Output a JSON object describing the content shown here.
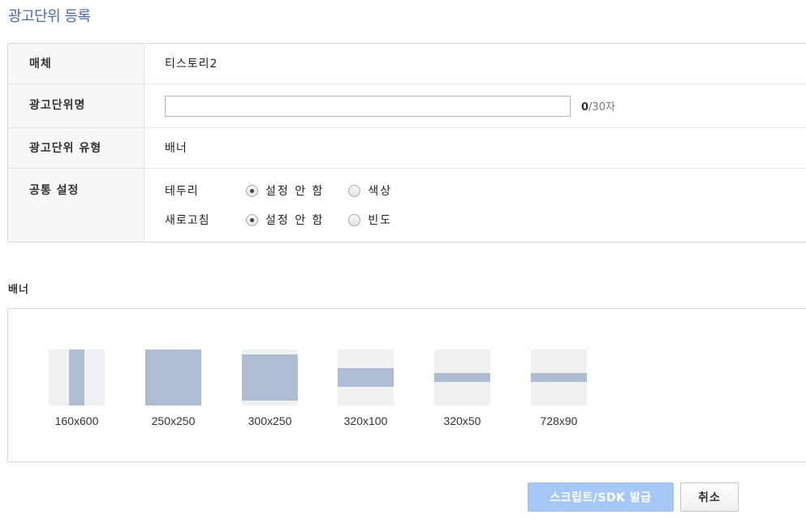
{
  "page_title": "광고단위 등록",
  "form": {
    "media": {
      "label": "매체",
      "value": "티스토리2"
    },
    "name": {
      "label": "광고단위명",
      "value": "",
      "placeholder": "",
      "count_current": "0",
      "count_max": "/30자"
    },
    "type": {
      "label": "광고단위 유형",
      "value": "배너"
    },
    "common": {
      "label": "공통 설정",
      "border": {
        "label": "테두리",
        "options": [
          "설정 안 함",
          "색상"
        ],
        "selected": "설정 안 함"
      },
      "refresh": {
        "label": "새로고침",
        "options": [
          "설정 안 함",
          "빈도"
        ],
        "selected": "설정 안 함"
      }
    }
  },
  "banner_section": {
    "title": "배너",
    "sizes": [
      "160x600",
      "250x250",
      "300x250",
      "320x100",
      "320x50",
      "728x90"
    ]
  },
  "buttons": {
    "issue": "스크립트/SDK 발급",
    "cancel": "취소"
  },
  "colors": {
    "title": "#4a6aa5",
    "thumb_bg": "#f0f1f3",
    "thumb_fill": "#aebdd1",
    "primary_disabled": "#a5c8f7"
  }
}
